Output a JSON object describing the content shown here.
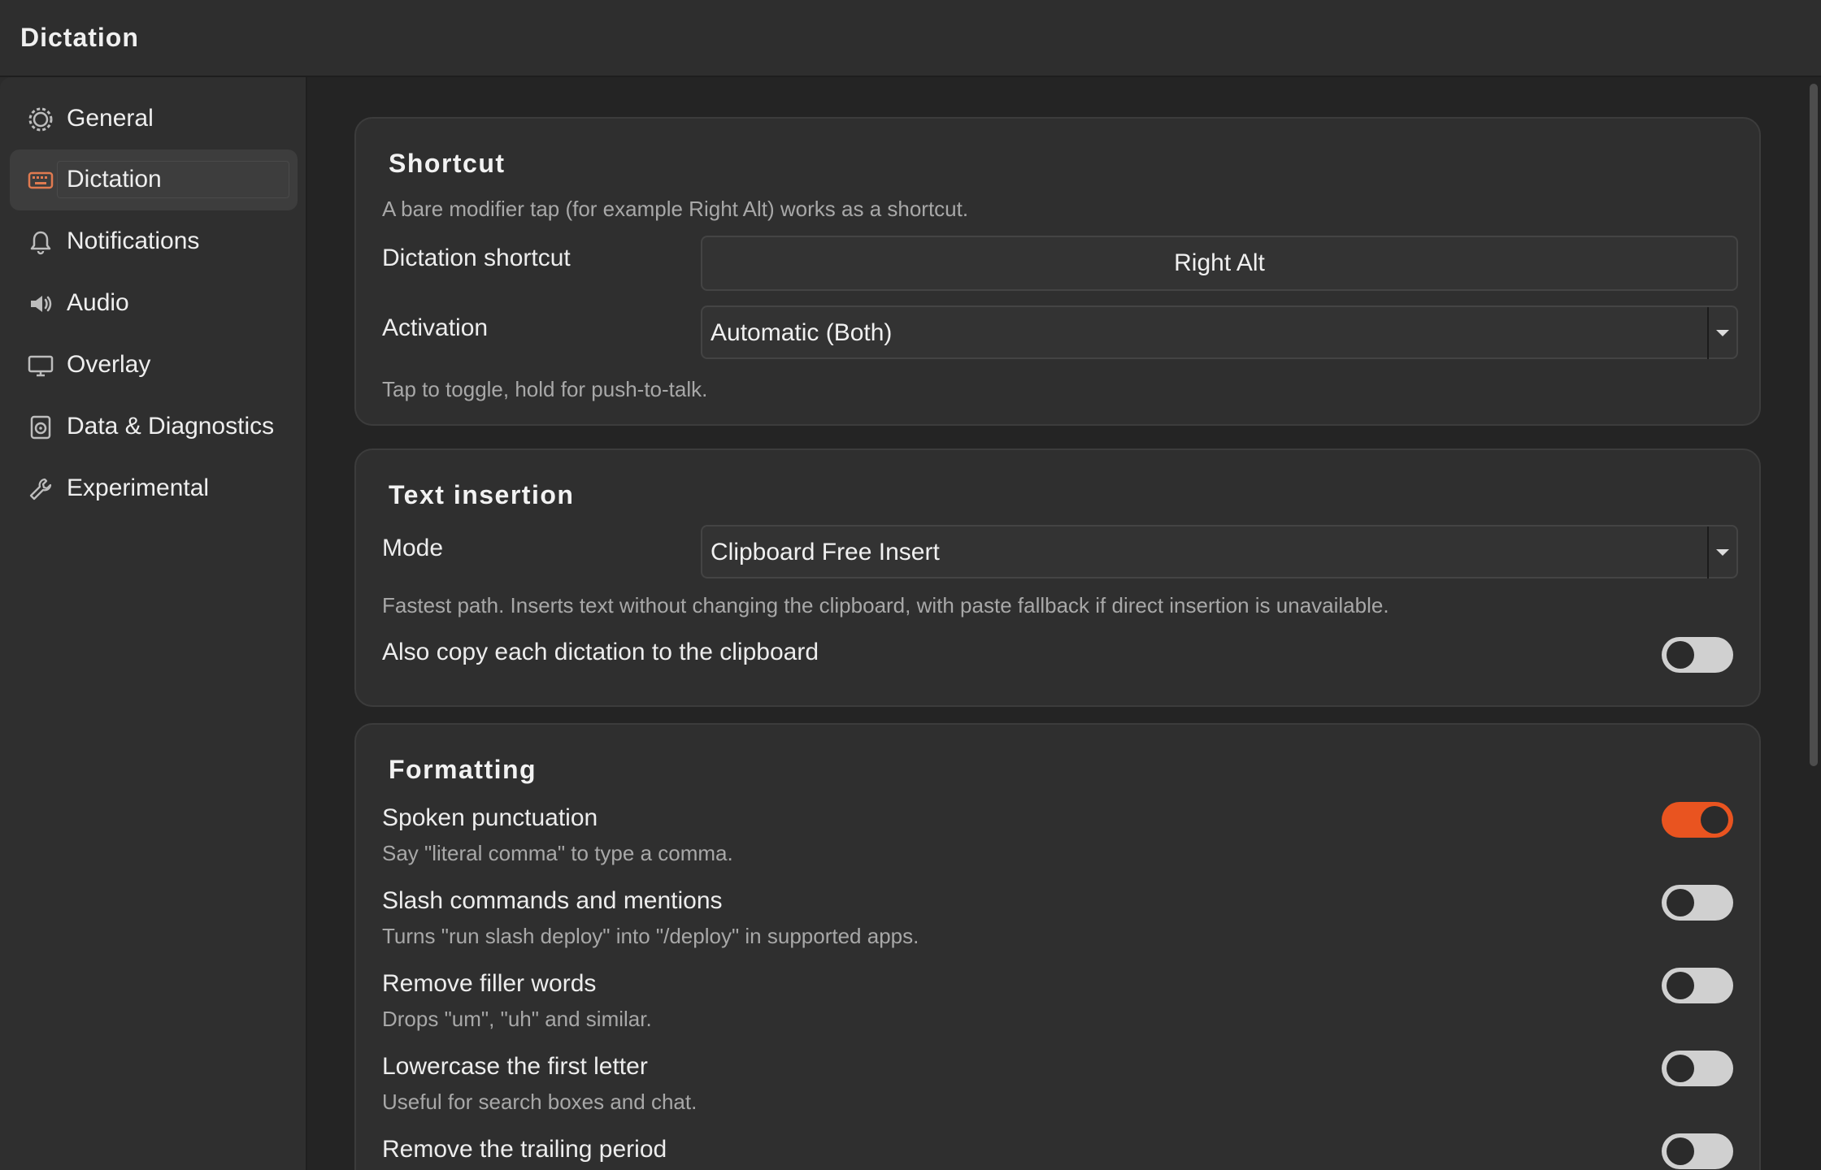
{
  "window": {
    "title": "Dictation"
  },
  "sidebar": {
    "items": [
      {
        "label": "General",
        "icon": "gear-icon"
      },
      {
        "label": "Dictation",
        "icon": "keyboard-icon",
        "active": true
      },
      {
        "label": "Notifications",
        "icon": "bell-icon"
      },
      {
        "label": "Audio",
        "icon": "speaker-icon"
      },
      {
        "label": "Overlay",
        "icon": "monitor-icon"
      },
      {
        "label": "Data & Diagnostics",
        "icon": "drive-icon"
      },
      {
        "label": "Experimental",
        "icon": "wrench-icon"
      }
    ]
  },
  "shortcut": {
    "title": "Shortcut",
    "description": "A bare modifier tap (for example Right Alt) works as a shortcut.",
    "dictation_shortcut_label": "Dictation shortcut",
    "dictation_shortcut_value": "Right Alt",
    "activation_label": "Activation",
    "activation_value": "Automatic (Both)",
    "activation_hint": "Tap to toggle, hold for push-to-talk."
  },
  "text_insertion": {
    "title": "Text insertion",
    "mode_label": "Mode",
    "mode_value": "Clipboard Free Insert",
    "mode_description": "Fastest path. Inserts text without changing the clipboard, with paste fallback if direct insertion is unavailable.",
    "copy_label": "Also copy each dictation to the clipboard",
    "copy_enabled": false
  },
  "formatting": {
    "title": "Formatting",
    "options": [
      {
        "label": "Spoken punctuation",
        "description": "Say \"literal comma\" to type a comma.",
        "enabled": true
      },
      {
        "label": "Slash commands and mentions",
        "description": "Turns \"run slash deploy\" into \"/deploy\" in supported apps.",
        "enabled": false
      },
      {
        "label": "Remove filler words",
        "description": "Drops \"um\", \"uh\" and similar.",
        "enabled": false
      },
      {
        "label": "Lowercase the first letter",
        "description": "Useful for search boxes and chat.",
        "enabled": false
      },
      {
        "label": "Remove the trailing period",
        "description": "",
        "enabled": false
      }
    ]
  },
  "colors": {
    "accent": "#e95420",
    "toggle_off": "#d0d0d0",
    "card": "#2f2f2f",
    "background": "#242424"
  }
}
